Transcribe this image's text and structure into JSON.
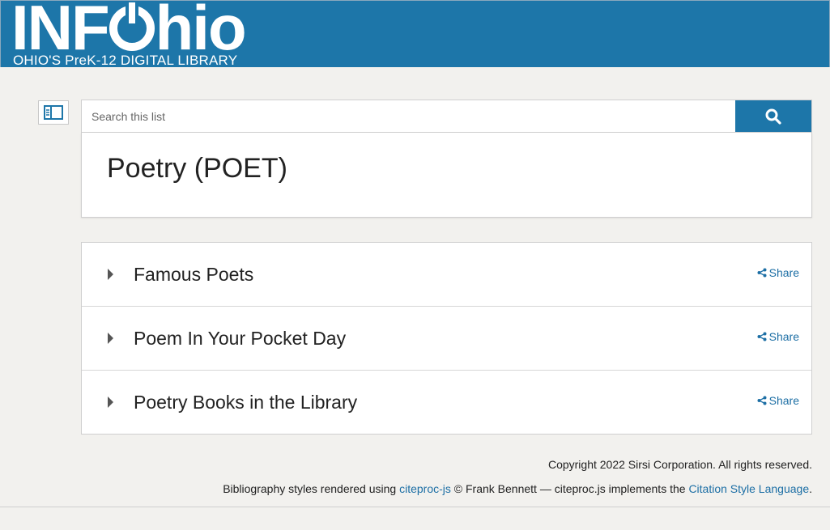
{
  "header": {
    "logo_left": "INF",
    "logo_right": "hio",
    "tagline": "OHIO'S PreK-12 DIGITAL LIBRARY",
    "background_color": "#1d76a9"
  },
  "search": {
    "placeholder": "Search this list",
    "value": "",
    "button_icon": "search-icon"
  },
  "sidebar_toggle_icon": "sidebar-panel-icon",
  "page_title": "Poetry (POET)",
  "items": [
    {
      "title": "Famous Poets",
      "share_label": "Share"
    },
    {
      "title": "Poem In Your Pocket Day",
      "share_label": "Share"
    },
    {
      "title": "Poetry Books in the Library",
      "share_label": "Share"
    }
  ],
  "footer": {
    "copyright": "Copyright 2022 Sirsi Corporation. All rights reserved.",
    "biblio_prefix": "Bibliography styles rendered using ",
    "biblio_link1": "citeproc-js",
    "biblio_middle": " © Frank Bennett — citeproc.js implements the ",
    "biblio_link2": "Citation Style Language",
    "biblio_suffix": "."
  },
  "link_color": "#1d6fa5"
}
